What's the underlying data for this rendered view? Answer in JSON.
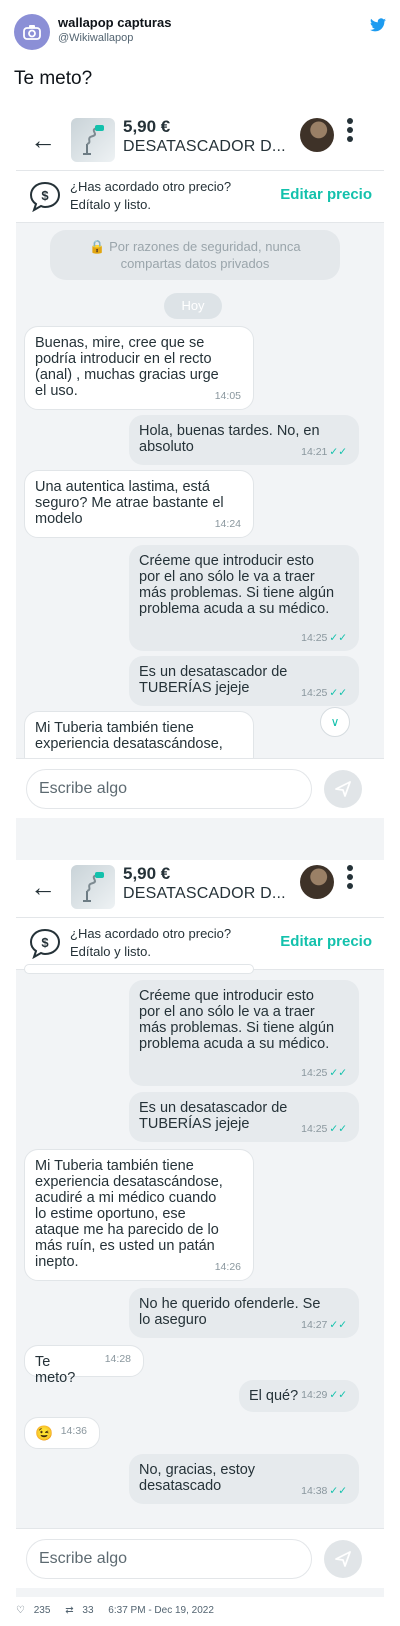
{
  "tweet": {
    "author_name": "wallapop capturas",
    "author_handle": "@Wikiwallapop",
    "text": "Te meto?",
    "likes": "235",
    "retweets": "33",
    "timestamp": "6:37 PM - Dec 19, 2022"
  },
  "chat": {
    "price": "5,90 €",
    "product_title": "DESATASCADOR D...",
    "offer_line1": "¿Has acordado otro precio?",
    "offer_line2": "Edítalo y listo.",
    "edit_price_label": "Editar precio",
    "security_line1": "🔒 Por razones de seguridad, nunca",
    "security_line2": "compartas datos privados",
    "day_label": "Hoy",
    "composer_placeholder": "Escribe algo"
  },
  "screen1_messages": [
    {
      "dir": "in",
      "text": "Buenas, mire, cree que se\npodría introducir en el recto\n(anal) , muchas gracias urge\nel uso.",
      "time": "14:05"
    },
    {
      "dir": "out",
      "text": "Hola, buenas tardes. No, en\nabsoluto",
      "time": "14:21"
    },
    {
      "dir": "in",
      "text": "Una autentica lastima, está\nseguro? Me atrae bastante el\nmodelo",
      "time": "14:24"
    },
    {
      "dir": "out",
      "text": "Créeme que introducir esto\npor el ano sólo le va a traer\nmás problemas. Si tiene algún\nproblema acuda a su médico.",
      "time": "14:25"
    },
    {
      "dir": "out",
      "text": "Es un desatascador de\nTUBERÍAS jejeje",
      "time": "14:25"
    },
    {
      "dir": "in",
      "text": "Mi Tuberia también tiene\nexperiencia desatascándose,",
      "time": ""
    }
  ],
  "screen2_messages": [
    {
      "dir": "out",
      "text": "Créeme que introducir esto\npor el ano sólo le va a traer\nmás problemas. Si tiene algún\nproblema acuda a su médico.",
      "time": "14:25"
    },
    {
      "dir": "out",
      "text": "Es un desatascador de\nTUBERÍAS jejeje",
      "time": "14:25"
    },
    {
      "dir": "in",
      "text": "Mi Tuberia también tiene\nexperiencia desatascándose,\nacudiré a mi médico cuando\nlo estime oportuno, ese\nataque me ha parecido de lo\nmás ruín, es usted un patán\ninepto.",
      "time": "14:26"
    },
    {
      "dir": "out",
      "text": "No he querido ofenderle. Se\nlo aseguro",
      "time": "14:27"
    },
    {
      "dir": "in",
      "text": "Te meto?",
      "time": "14:28"
    },
    {
      "dir": "out",
      "text": "El qué?",
      "time": "14:29"
    },
    {
      "dir": "in",
      "text": "😉",
      "time": "14:36"
    },
    {
      "dir": "out",
      "text": "No, gracias, estoy\ndesatascado",
      "time": "14:38"
    }
  ],
  "colors": {
    "accent": "#13c1ac",
    "outgoing_bubble": "#e6eaed",
    "chat_background": "#f2f4f6"
  },
  "icons": [
    "back-arrow-icon",
    "kebab-menu-icon",
    "price-offer-icon",
    "lock-icon",
    "chevron-down-icon",
    "send-icon",
    "twitter-bird-icon",
    "like-icon",
    "retweet-icon"
  ]
}
